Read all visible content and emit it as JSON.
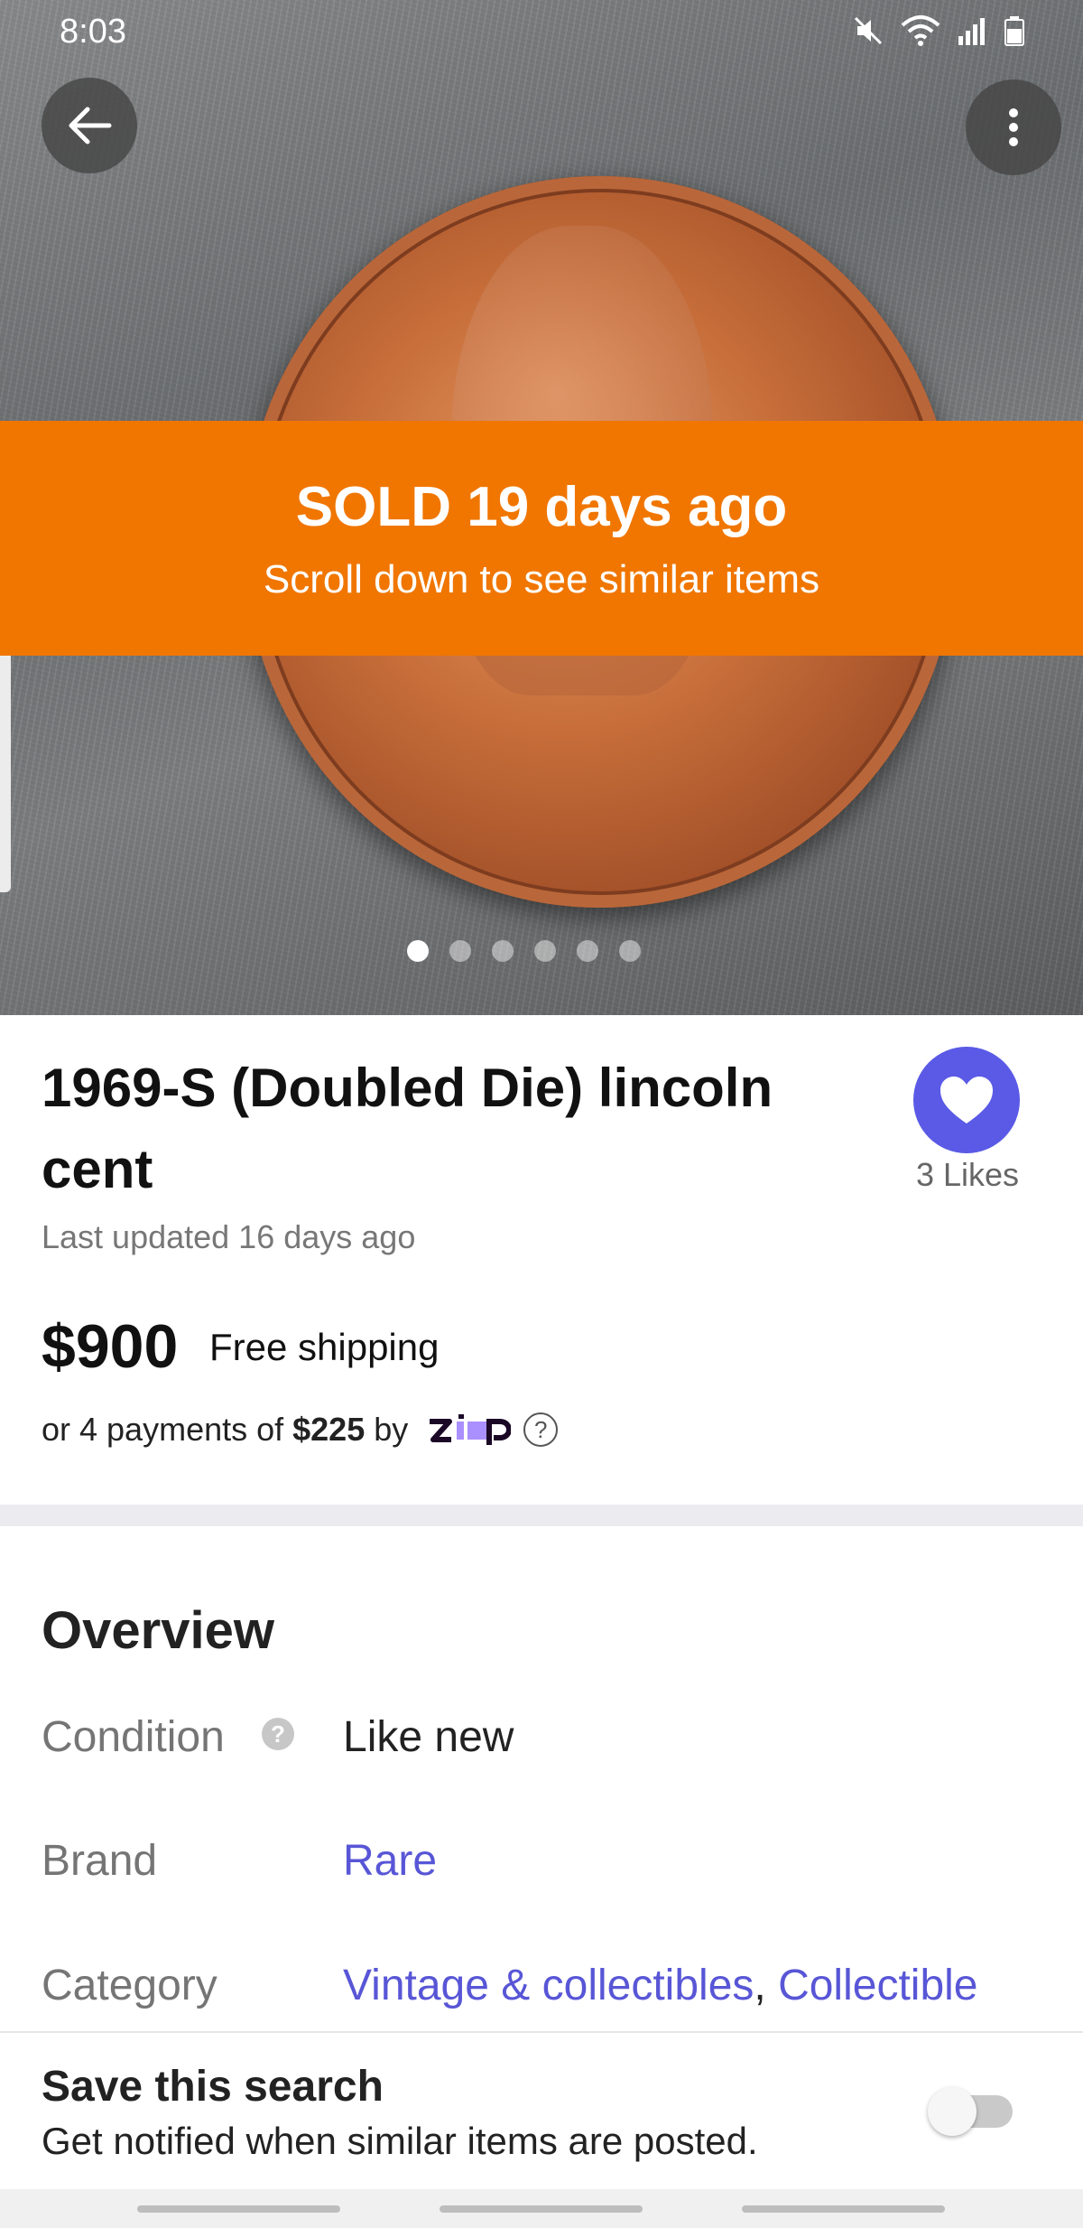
{
  "status_bar": {
    "time": "8:03"
  },
  "hero": {
    "sold_title": "SOLD 19 days ago",
    "sold_subtitle": "Scroll down to see similar items",
    "photo_count": 6,
    "active_photo": 1
  },
  "product": {
    "title": "1969-S (Doubled Die) lincoln cent",
    "likes": "3 Likes",
    "updated": "Last updated 16 days ago",
    "price": "$900",
    "shipping": "Free shipping",
    "payments_prefix": "or 4 payments of ",
    "payments_amount": "$225",
    "payments_by": " by "
  },
  "overview": {
    "heading": "Overview",
    "rows": [
      {
        "label": "Condition",
        "value": "Like new"
      },
      {
        "label": "Brand",
        "value": "Rare"
      },
      {
        "label": "Category",
        "value_1": "Vintage & collectibles",
        "separator": ", ",
        "value_2": "Collectible"
      }
    ]
  },
  "save_search": {
    "title": "Save this search",
    "subtitle": "Get notified when similar items are posted.",
    "enabled": false
  },
  "colors": {
    "sold_banner": "#f07600",
    "accent": "#5a5ae6",
    "link": "#5856d6"
  }
}
